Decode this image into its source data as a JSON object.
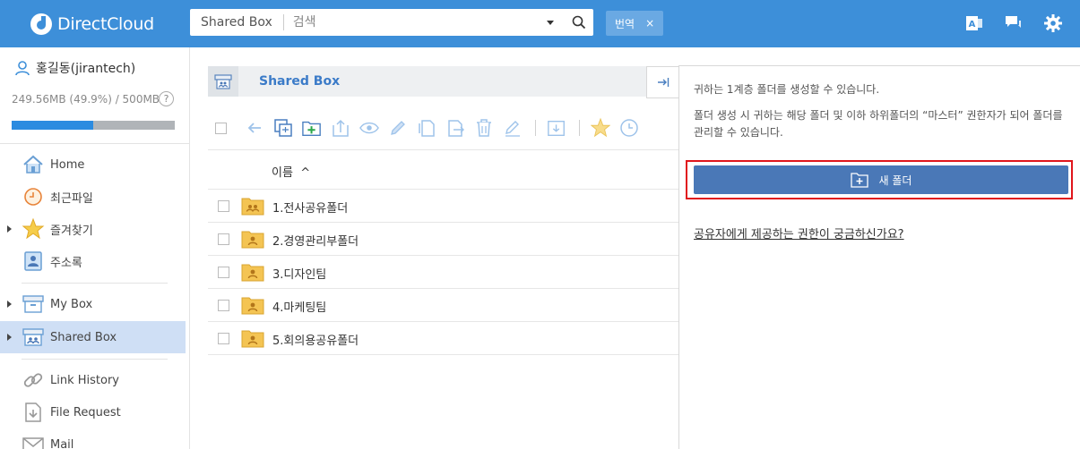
{
  "header": {
    "logo_text": "DirectCloud",
    "search_scope": "Shared Box",
    "search_placeholder": "검색",
    "tag_label": "번역",
    "tag_close": "×"
  },
  "sidebar": {
    "user_name": "홍길동(jirantech)",
    "quota_text": "249.56MB (49.9%) / 500MB",
    "quota_percent": 49.9,
    "help_label": "?",
    "items": [
      {
        "label": "Home",
        "icon": "home-icon"
      },
      {
        "label": "최근파일",
        "icon": "clock-icon"
      },
      {
        "label": "즐겨찾기",
        "icon": "star-icon"
      },
      {
        "label": "주소록",
        "icon": "contacts-icon"
      },
      {
        "label": "My Box",
        "icon": "box-icon"
      },
      {
        "label": "Shared Box",
        "icon": "shared-box-icon"
      },
      {
        "label": "Link History",
        "icon": "link-icon"
      },
      {
        "label": "File Request",
        "icon": "file-request-icon"
      },
      {
        "label": "Mail",
        "icon": "mail-icon"
      }
    ]
  },
  "main": {
    "breadcrumb_title": "Shared Box",
    "column_name": "이름",
    "sort_indicator": "^",
    "rows": [
      {
        "name": "1.전사공유폴더",
        "type": "shared"
      },
      {
        "name": "2.경영관리부폴더",
        "type": "user"
      },
      {
        "name": "3.디자인팀",
        "type": "user"
      },
      {
        "name": "4.마케팅팀",
        "type": "user"
      },
      {
        "name": "5.회의용공유폴더",
        "type": "user"
      }
    ]
  },
  "panel": {
    "text1": "귀하는 1계층 폴더를 생성할 수 있습니다.",
    "text2": "폴더 생성 시 귀하는 해당 폴더 및 이하 하위폴더의 “마스터” 권한자가 되어 폴더를 관리할 수 있습니다.",
    "new_folder_label": "새 폴더",
    "permissions_link": "공유자에게 제공하는 권한이 궁금하신가요?"
  },
  "colors": {
    "header_bg": "#3d8fd9",
    "accent_button": "#4a78b7",
    "highlight": "#e0161c",
    "active_nav": "#cfdff5",
    "folder": "#f4c453"
  }
}
